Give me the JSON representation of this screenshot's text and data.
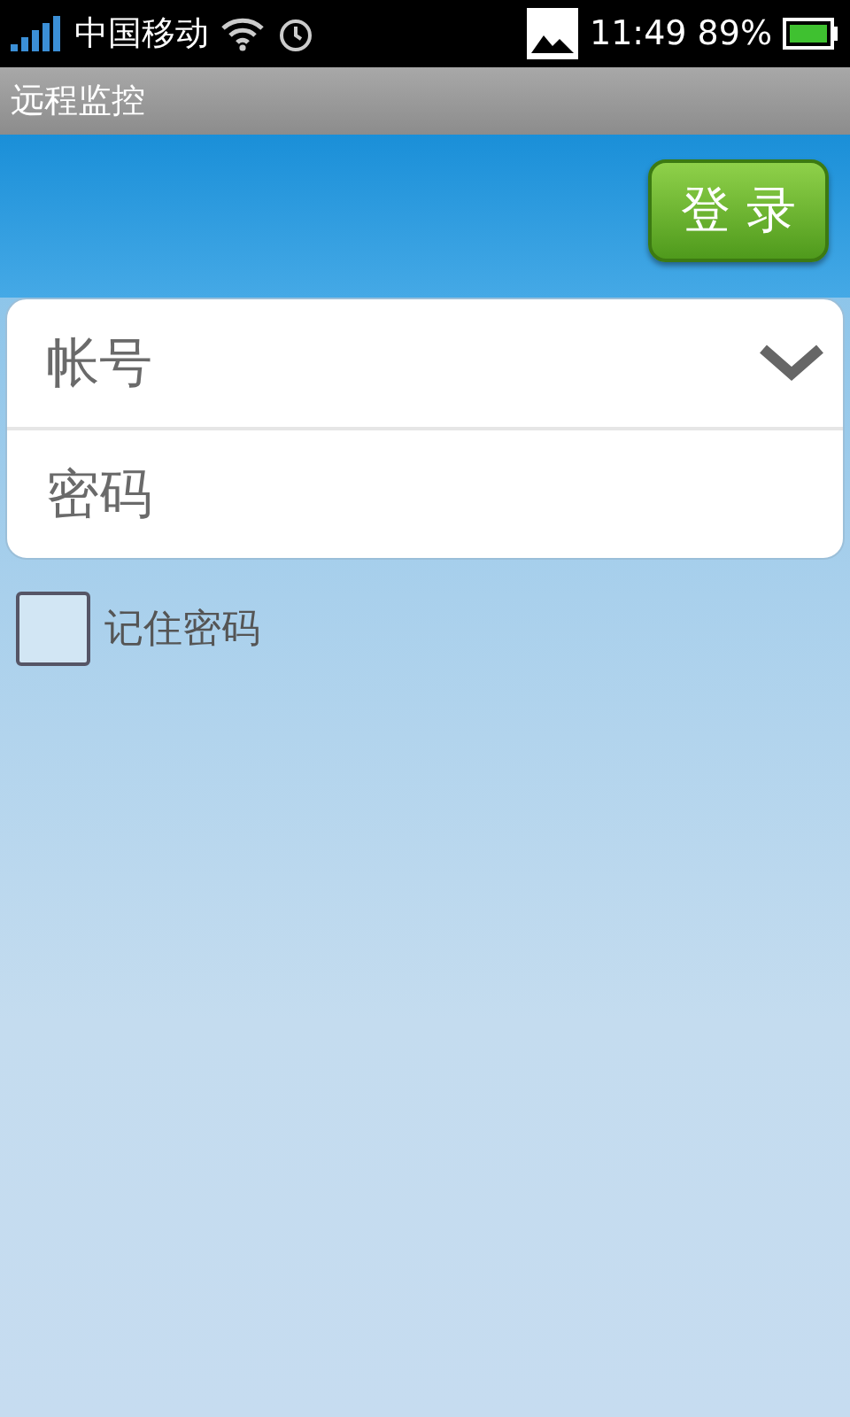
{
  "status_bar": {
    "carrier": "中国移动",
    "time": "11:49",
    "battery": "89%"
  },
  "window": {
    "title": "远程监控"
  },
  "login_button": {
    "label": "登 录"
  },
  "account_field": {
    "placeholder": "帐号"
  },
  "password_field": {
    "placeholder": "密码"
  },
  "remember": {
    "label": "记住密码",
    "checked": false
  }
}
